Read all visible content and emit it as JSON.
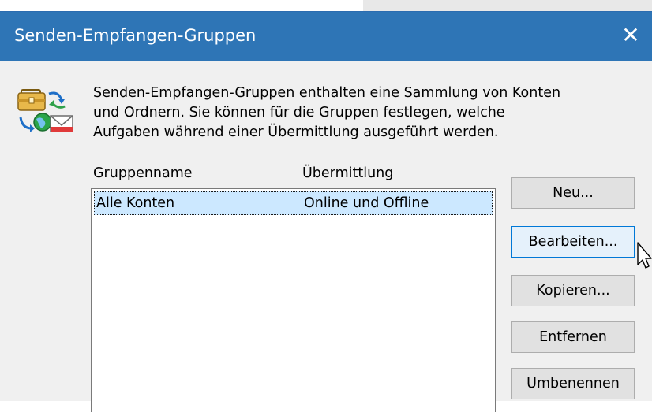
{
  "window": {
    "title": "Senden-Empfangen-Gruppen",
    "close_glyph": "✕"
  },
  "icon": "send-receive-groups-icon",
  "intro": {
    "line1": "Senden-Empfangen-Gruppen enthalten eine Sammlung von Konten",
    "line2": "und Ordnern. Sie können für die Gruppen festlegen, welche",
    "line3": "Aufgaben während einer Übermittlung ausgeführt werden."
  },
  "list": {
    "columns": [
      "Gruppenname",
      "Übermittlung"
    ],
    "rows": [
      {
        "name": "Alle Konten",
        "transfer": "Online und Offline",
        "selected": true
      }
    ]
  },
  "buttons": {
    "new": "Neu...",
    "edit": "Bearbeiten...",
    "copy": "Kopieren...",
    "remove": "Entfernen",
    "rename": "Umbenennen"
  },
  "colors": {
    "titlebar": "#2e75b6",
    "selection": "#cce8ff",
    "hover_border": "#0078d7"
  }
}
